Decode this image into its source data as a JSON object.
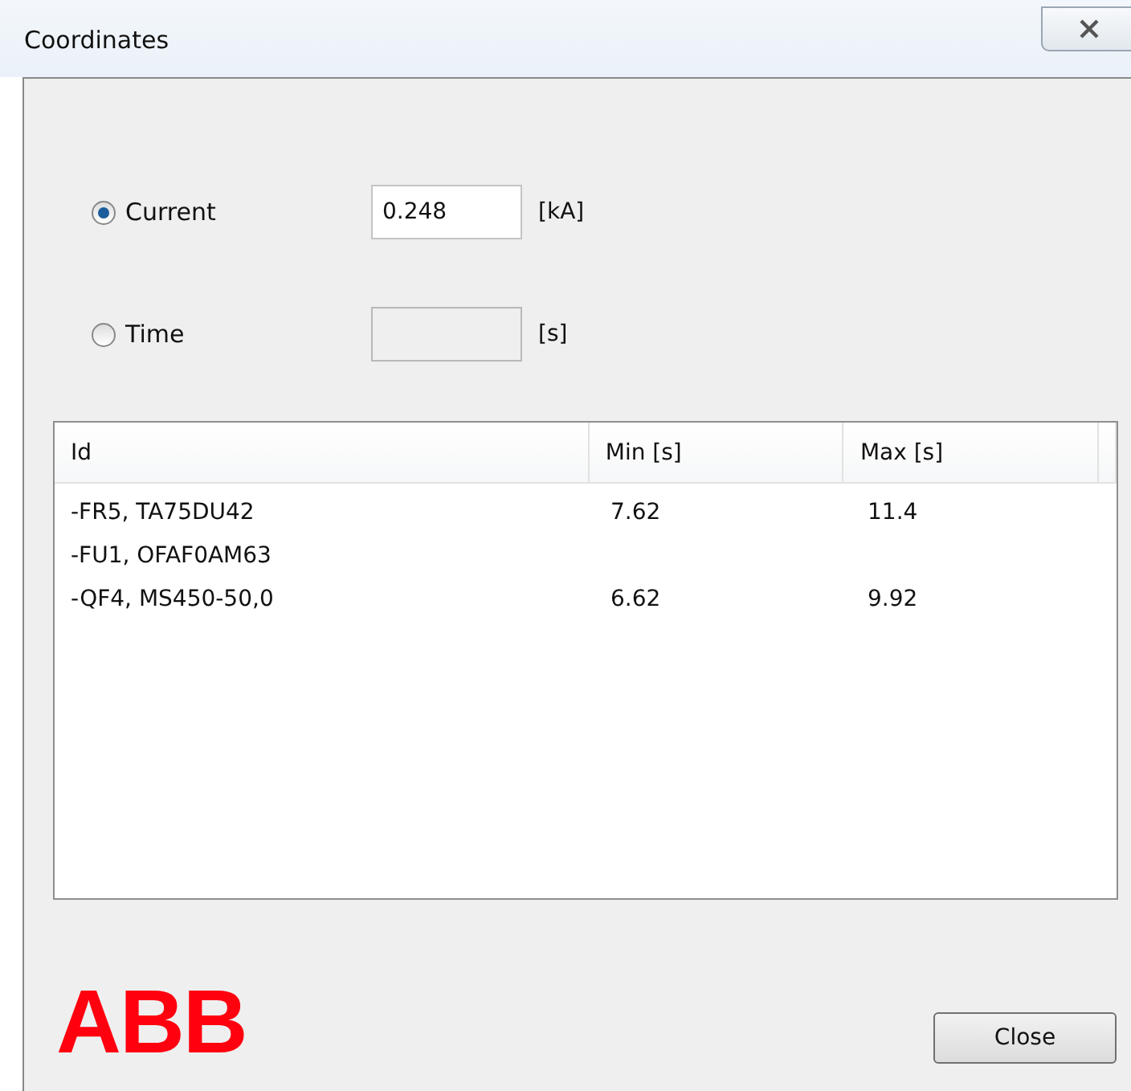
{
  "window": {
    "title": "Coordinates"
  },
  "options": [
    {
      "label": "Current",
      "selected": true,
      "value": "0.248",
      "unit": "[kA]",
      "disabled": false
    },
    {
      "label": "Time",
      "selected": false,
      "unit": "[s]",
      "disabled": true
    }
  ],
  "table": {
    "columns": [
      "Id",
      "Min [s]",
      "Max [s]"
    ],
    "rows": [
      [
        "-FR5, TA75DU42",
        "7.62",
        "11.4"
      ],
      [
        "-FU1, OFAF0AM63",
        "",
        ""
      ],
      [
        "-QF4, MS450-50,0",
        "6.62",
        "9.92"
      ]
    ]
  },
  "logo": "ABB",
  "buttons": [
    "Close"
  ]
}
